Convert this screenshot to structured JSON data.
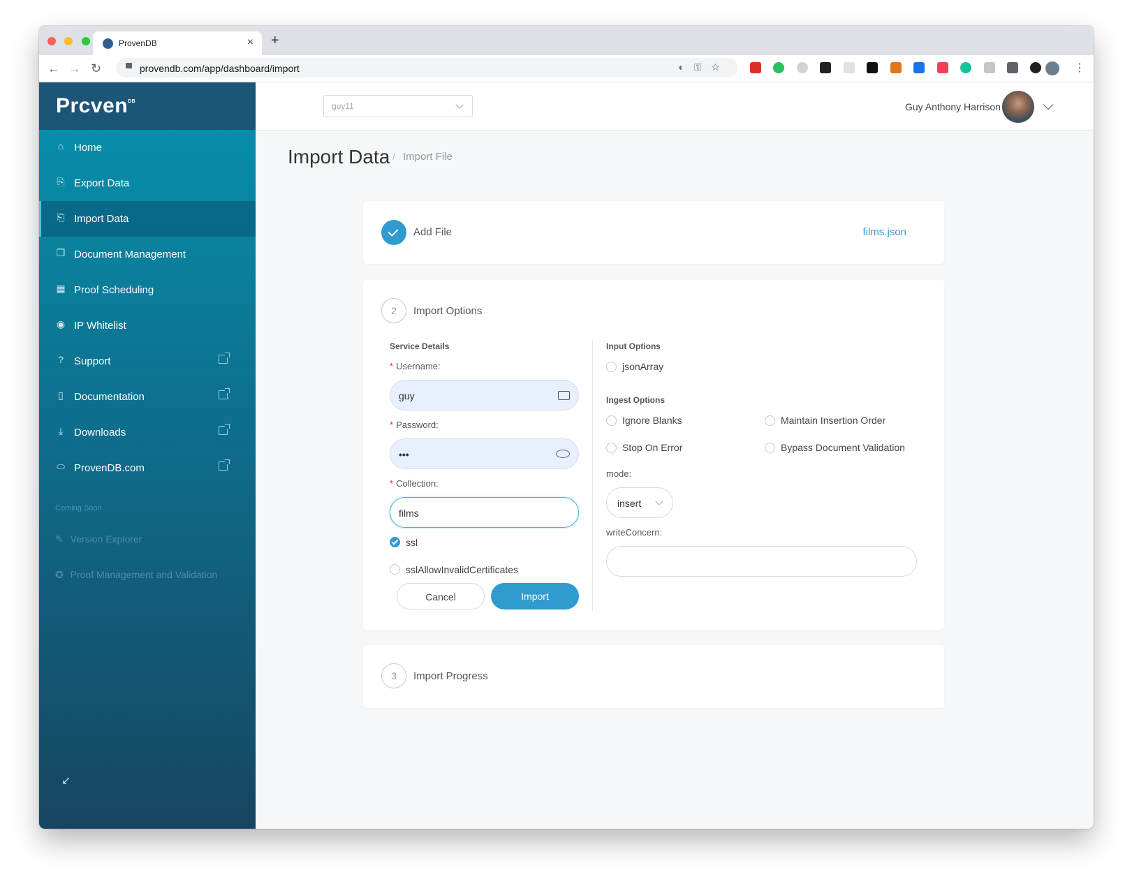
{
  "browser": {
    "tab_title": "ProvenDB",
    "tab_close": "×",
    "new_tab": "+",
    "url": "provendb.com/app/dashboard/import",
    "back": "←",
    "forward": "→",
    "reload": "↻",
    "menu": "⋮"
  },
  "app": {
    "logo_text": "Prcven",
    "logo_sup": "DB",
    "database": "guy11",
    "user_name": "Guy Anthony Harrison"
  },
  "sidebar": {
    "items": [
      {
        "label": "Home",
        "icon": "⌂"
      },
      {
        "label": "Export Data",
        "icon": "⎘"
      },
      {
        "label": "Import Data",
        "icon": "⎗"
      },
      {
        "label": "Document Management",
        "icon": "❐"
      },
      {
        "label": "Proof Scheduling",
        "icon": "▦"
      },
      {
        "label": "IP Whitelist",
        "icon": "◉"
      },
      {
        "label": "Support",
        "icon": "?"
      },
      {
        "label": "Documentation",
        "icon": "▯"
      },
      {
        "label": "Downloads",
        "icon": "⤓"
      },
      {
        "label": "ProvenDB.com",
        "icon": "⬭"
      }
    ],
    "coming_soon": "Coming Soon",
    "disabled": [
      {
        "label": "Version Explorer",
        "icon": "✎"
      },
      {
        "label": "Proof Management and Validation",
        "icon": "✪"
      }
    ],
    "collapse_icon": "↙"
  },
  "page": {
    "title": "Import Data",
    "breadcrumb_sep": "/",
    "breadcrumb": "Import File"
  },
  "step1": {
    "title": "Add File",
    "file_name": "films.json"
  },
  "step2": {
    "number": "2",
    "title": "Import Options",
    "service_details": "Service Details",
    "username_label": "Username",
    "username_value": "guy",
    "password_label": "Password",
    "password_value": "•••",
    "collection_label": "Collection",
    "collection_value": "films",
    "ssl_label": "ssl",
    "ssl_invalid_label": "sslAllowInvalidCertificates",
    "cancel_label": "Cancel",
    "import_label": "Import",
    "input_options": "Input Options",
    "json_array_label": "jsonArray",
    "ingest_options": "Ingest Options",
    "ignore_blanks_label": "Ignore Blanks",
    "maintain_order_label": "Maintain Insertion Order",
    "stop_on_error_label": "Stop On Error",
    "bypass_validation_label": "Bypass Document Validation",
    "mode_label": "mode",
    "mode_value": "insert",
    "write_concern_label": "writeConcern",
    "write_concern_value": "",
    "required_mark": "*",
    "colon": ":"
  },
  "step3": {
    "number": "3",
    "title": "Import Progress"
  },
  "colors": {
    "accent": "#2f9bcf",
    "sidebar_top": "#0592ad",
    "sidebar_bottom": "#164561"
  }
}
